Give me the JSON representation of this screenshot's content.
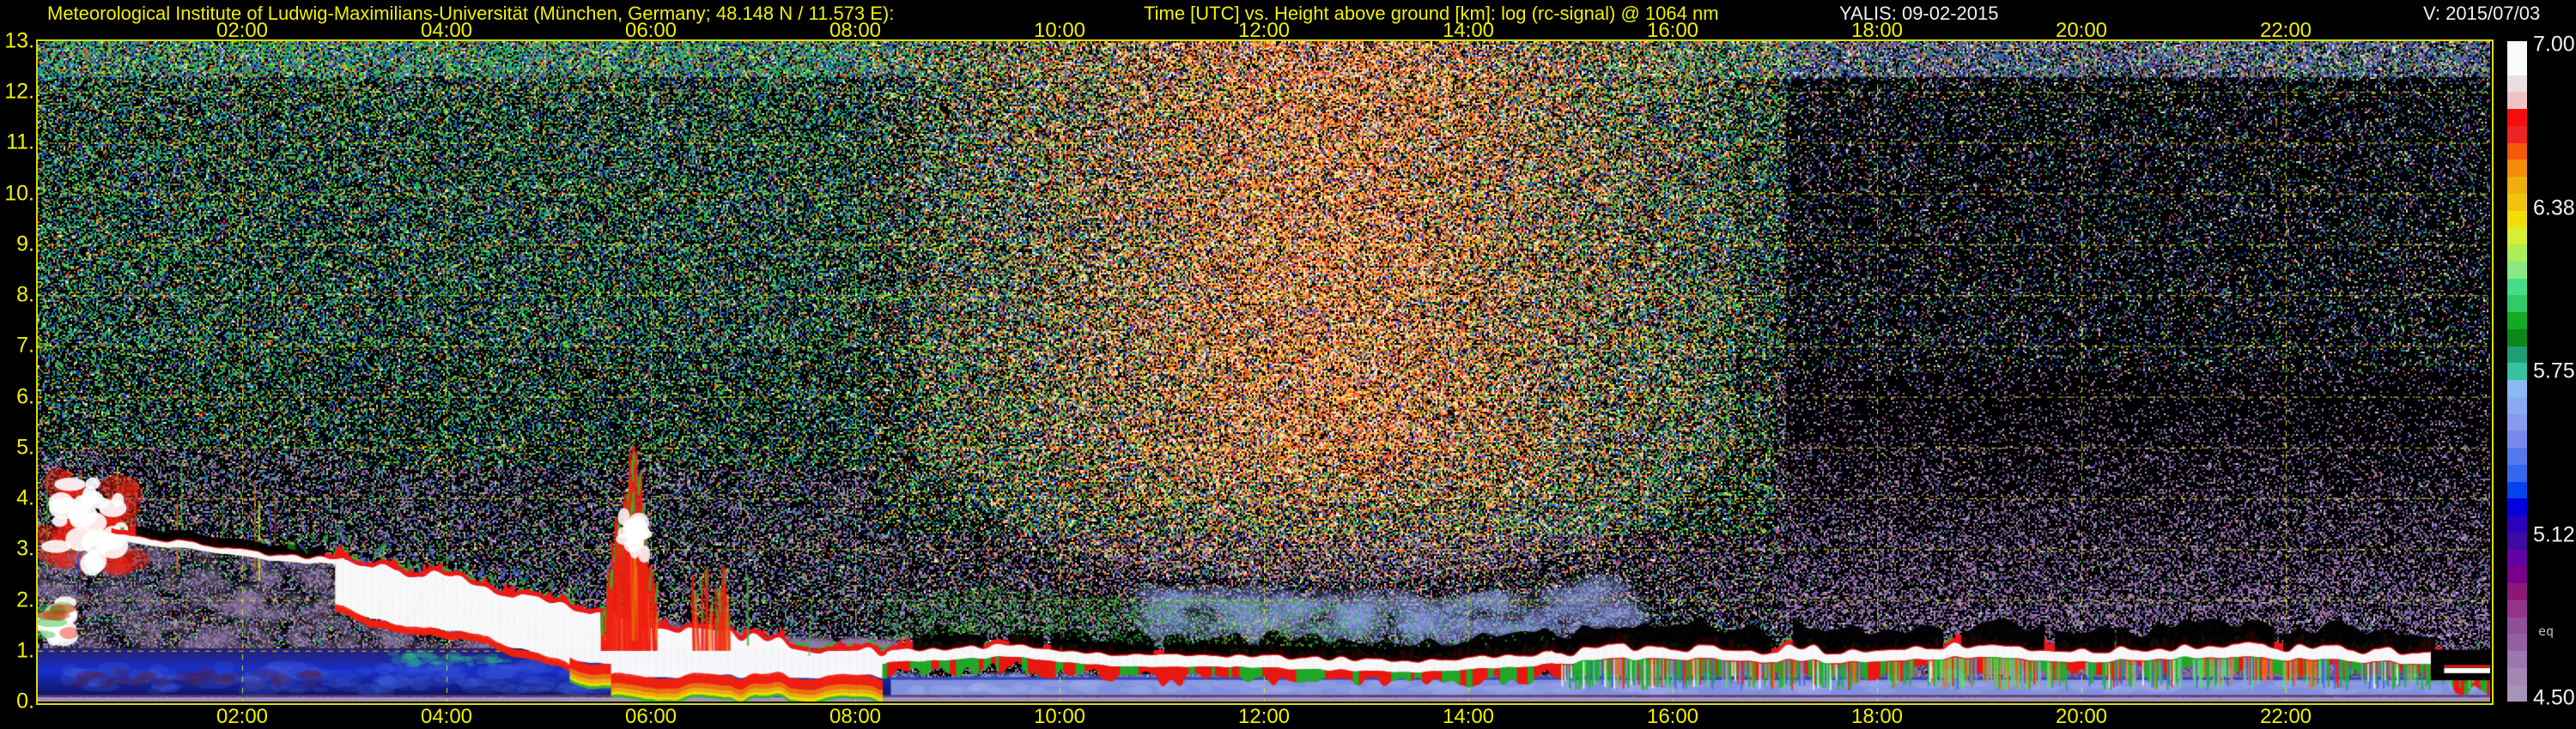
{
  "header": {
    "institute": "Meteorological Institute of Ludwig-Maximilians-Universität (München, Germany; 48.148 N / 11.573 E):",
    "plot_title": "Time [UTC] vs. Height above ground [km]: log (rc-signal) @ 1064 nm",
    "instrument_date": "YALIS: 09-02-2015",
    "version": "V: 2015/07/03"
  },
  "colors": {
    "background": "#000000",
    "axis_text": "#f2f200",
    "white_text": "#f0f0f0",
    "grid": "#e8e800",
    "frame": "#dede00"
  },
  "chart_data": {
    "type": "heatmap",
    "title": "Time [UTC] vs. Height above ground [km]: log (rc-signal) @ 1064 nm",
    "xlabel": "Time [UTC]",
    "ylabel": "Height above ground [km]",
    "x_range_hours": [
      0,
      24
    ],
    "y_range_km": [
      0,
      13
    ],
    "grid": "dashed yellow, every 2 h and every 1 km",
    "x_tick_hours": [
      2,
      4,
      6,
      8,
      10,
      12,
      14,
      16,
      18,
      20,
      22
    ],
    "x_tick_labels": [
      "02:00",
      "04:00",
      "06:00",
      "08:00",
      "10:00",
      "12:00",
      "14:00",
      "16:00",
      "18:00",
      "20:00",
      "22:00"
    ],
    "y_tick_labels": [
      "0.",
      "1.",
      "2.",
      "3.",
      "4.",
      "5.",
      "6.",
      "7.",
      "8.",
      "9.",
      "10.",
      "11.",
      "12.",
      "13."
    ],
    "colorbar": {
      "tick_labels_top_to_bottom": [
        "7.00",
        "6.38",
        "5.75",
        "5.12",
        "4.50"
      ],
      "side_note": "eq",
      "value_top": 7.0,
      "value_bottom": 4.5,
      "colors_top_to_bottom": [
        "#fbfbfb",
        "#fbfbfb",
        "#e9dfe3",
        "#f0c2c6",
        "#f50c0c",
        "#ee2326",
        "#f55808",
        "#f28c0a",
        "#efae0e",
        "#f0c40e",
        "#f2de08",
        "#d8ee32",
        "#abee55",
        "#8ae785",
        "#45dc8b",
        "#2fcb67",
        "#13a922",
        "#0b8818",
        "#1f9e76",
        "#36c2a0",
        "#8db9f2",
        "#89a9f0",
        "#8899ee",
        "#7889ee",
        "#5678ee",
        "#3467ed",
        "#0345ec",
        "#0203dc",
        "#2a02bb",
        "#3d0ba0",
        "#6202a2",
        "#750287",
        "#8b1879",
        "#93348c",
        "#8d4f97",
        "#9260a0",
        "#9b77ae",
        "#a288b3",
        "#a893b8"
      ]
    },
    "boundary_layer_top_km": {
      "hours": [
        0.7,
        1,
        1.5,
        2,
        2.5,
        3,
        3.5,
        4,
        4.5,
        5,
        5.5,
        6,
        6.5,
        7,
        7.5,
        8,
        8.5,
        9,
        9.5,
        10,
        10.5,
        11,
        11.5,
        12,
        12.5,
        13,
        13.5,
        14,
        14.5,
        15,
        15.5,
        16,
        16.5,
        17,
        17.5,
        18,
        18.5,
        19,
        19.5,
        20,
        20.5,
        21,
        21.5,
        22,
        22.5,
        23,
        23.4,
        23.7,
        24
      ],
      "km": [
        3.35,
        3.2,
        3.12,
        2.98,
        2.85,
        2.85,
        2.58,
        2.48,
        2.2,
        2.0,
        1.7,
        1.5,
        1.4,
        1.25,
        1.08,
        0.98,
        1.0,
        1.05,
        1.1,
        1.0,
        0.92,
        0.88,
        0.92,
        0.88,
        0.85,
        0.82,
        0.8,
        0.85,
        0.9,
        1.0,
        1.05,
        1.08,
        1.05,
        1.02,
        1.0,
        1.02,
        1.05,
        1.1,
        1.05,
        1.0,
        1.05,
        1.1,
        1.08,
        1.05,
        1.02,
        1.0,
        0.95,
        0.7,
        0.62
      ]
    },
    "features": [
      {
        "name": "nocturnal-cloud-cluster",
        "hours": [
          0.05,
          0.95
        ],
        "km": [
          2.5,
          4.5
        ]
      },
      {
        "name": "low-cloud-patch",
        "hours": [
          0.0,
          0.3
        ],
        "km": [
          1.2,
          2.0
        ]
      },
      {
        "name": "thick-morning-cloud",
        "hours": [
          2.9,
          8.2
        ],
        "km": [
          0.5,
          2.9
        ]
      },
      {
        "name": "convective-plume",
        "hours": [
          5.5,
          6.1
        ],
        "km": [
          1.0,
          4.3
        ]
      },
      {
        "name": "secondary-plume",
        "hours": [
          6.4,
          6.8
        ],
        "km": [
          1.0,
          2.7
        ]
      },
      {
        "name": "rainbow-near-ground-fringe",
        "hours": [
          5.2,
          8.25
        ],
        "km": [
          0.3,
          0.6
        ]
      },
      {
        "name": "black-attenuation-cap",
        "hours": [
          9.9,
          23.4
        ],
        "km": [
          1.0,
          1.6
        ]
      },
      {
        "name": "green-aerosol-band",
        "hours": [
          8.3,
          12.4
        ],
        "km": [
          1.1,
          2.0
        ]
      },
      {
        "name": "daytime-background-glow",
        "hours": [
          8.15,
          17.0
        ],
        "km": [
          2.0,
          13.0
        ]
      },
      {
        "name": "purple-residual-haze",
        "hours": [
          15.0,
          24.0
        ],
        "km": [
          1.2,
          6.5
        ]
      },
      {
        "name": "convective-streaks",
        "hours": [
          14.9,
          23.9
        ],
        "km": [
          0.25,
          1.0
        ]
      },
      {
        "name": "ground-blue-layer",
        "hours": [
          0.0,
          8.35
        ],
        "km": [
          0.1,
          1.0
        ]
      },
      {
        "name": "ground-periwinkle-layer",
        "hours": [
          8.35,
          24.0
        ],
        "km": [
          0.1,
          0.42
        ]
      },
      {
        "name": "antenna-spike-artifacts",
        "hours": [
          0.6,
          2.35
        ],
        "km": [
          2.4,
          4.7
        ]
      }
    ]
  }
}
